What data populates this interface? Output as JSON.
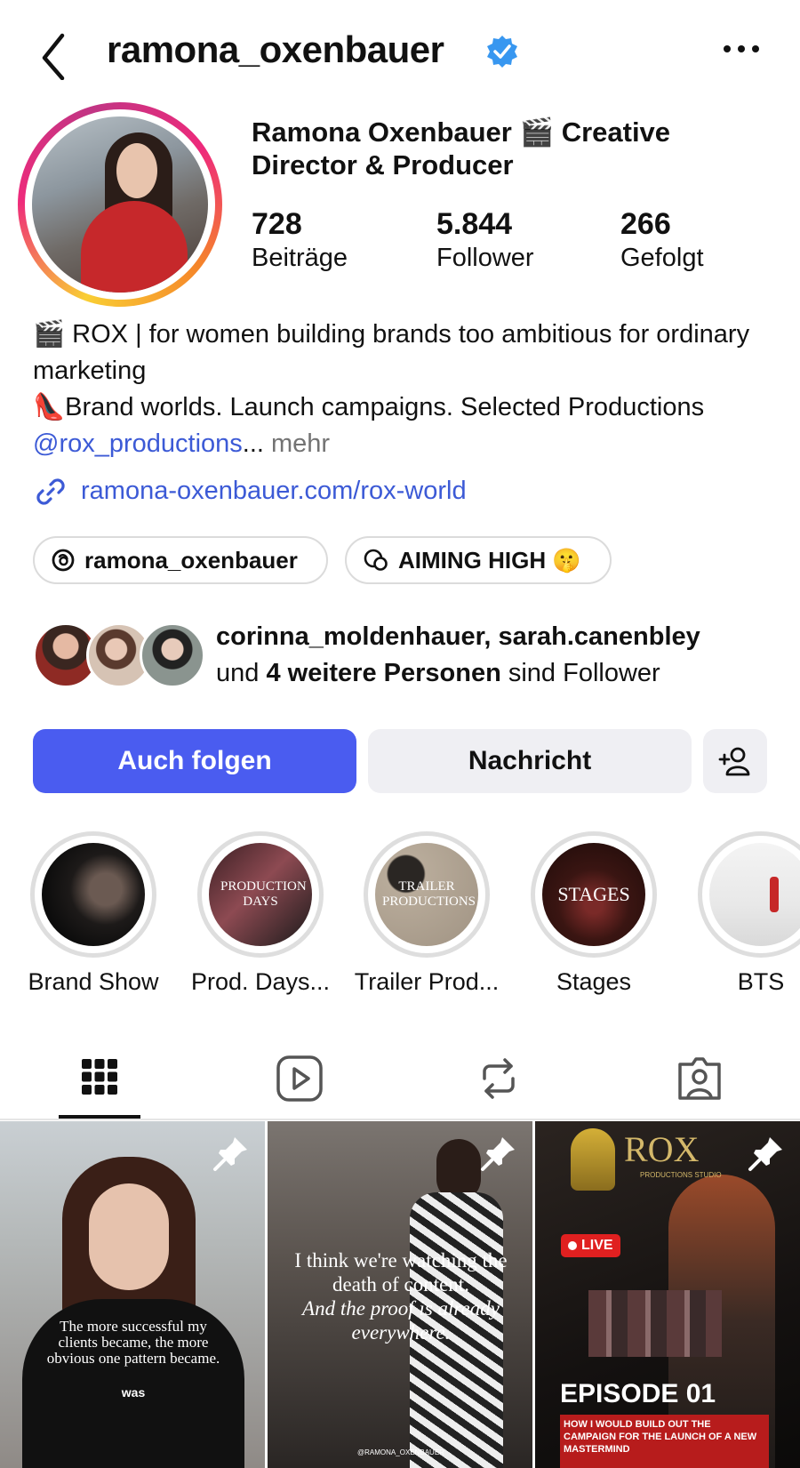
{
  "header": {
    "username": "ramona_oxenbauer",
    "back_icon": "chevron-left-icon",
    "verified_icon": "verified-badge-icon",
    "more_icon": "more-horizontal-icon"
  },
  "profile": {
    "display_name": "Ramona Oxenbauer 🎬 Creative Director & Producer",
    "stats": [
      {
        "value": "728",
        "label": "Beiträge"
      },
      {
        "value": "5.844",
        "label": "Follower"
      },
      {
        "value": "266",
        "label": "Gefolgt"
      }
    ],
    "bio_line1": "🎬 ROX | for women building brands too ambitious for ordinary marketing",
    "bio_line2_prefix": "👠Brand worlds. Launch campaigns. Selected Productions ",
    "bio_mention": "@rox_productions",
    "bio_ellipsis": "...",
    "bio_more": "mehr",
    "link_text": "ramona-oxenbauer.com/rox-world",
    "link_icon": "link-icon"
  },
  "chips": [
    {
      "icon": "threads-icon",
      "label": "ramona_oxenbauer"
    },
    {
      "icon": "chat-bubble-icon",
      "label": "AIMING HIGH 🤫"
    }
  ],
  "followed_by": {
    "names": "corinna_moldenhauer, sarah.canenbley",
    "and": "und ",
    "others": "4 weitere Personen",
    "suffix": " sind Follower"
  },
  "actions": {
    "follow_label": "Auch folgen",
    "message_label": "Nachricht",
    "add_user_icon": "add-user-icon"
  },
  "highlights": [
    {
      "label": "Brand Show",
      "overlay": ""
    },
    {
      "label": "Prod. Days...",
      "overlay": "PRODUCTION DAYS"
    },
    {
      "label": "Trailer Prod...",
      "overlay": "TRAILER PRODUCTIONS"
    },
    {
      "label": "Stages",
      "overlay": "STAGES"
    },
    {
      "label": "BTS",
      "overlay": ""
    }
  ],
  "tabs": [
    {
      "icon": "grid-icon",
      "active": true
    },
    {
      "icon": "reels-icon",
      "active": false
    },
    {
      "icon": "repost-icon",
      "active": false
    },
    {
      "icon": "tagged-icon",
      "active": false
    }
  ],
  "posts": [
    {
      "caption": "The more successful my clients became, the more obvious one pattern became.",
      "subcaption": "was",
      "pinned": true
    },
    {
      "caption": "I think we're watching the death of content.",
      "caption_italic": "And the proof is already everywhere.",
      "credit": "@RAMONA_OXENBAUER",
      "pinned": true
    },
    {
      "brand": "ROX",
      "brand_sub": "PRODUCTIONS STUDIO",
      "live": "LIVE",
      "episode": "EPISODE 01",
      "episode_sub": "HOW I WOULD BUILD OUT THE CAMPAIGN FOR THE LAUNCH OF A NEW MASTERMIND",
      "pinned": true
    }
  ]
}
